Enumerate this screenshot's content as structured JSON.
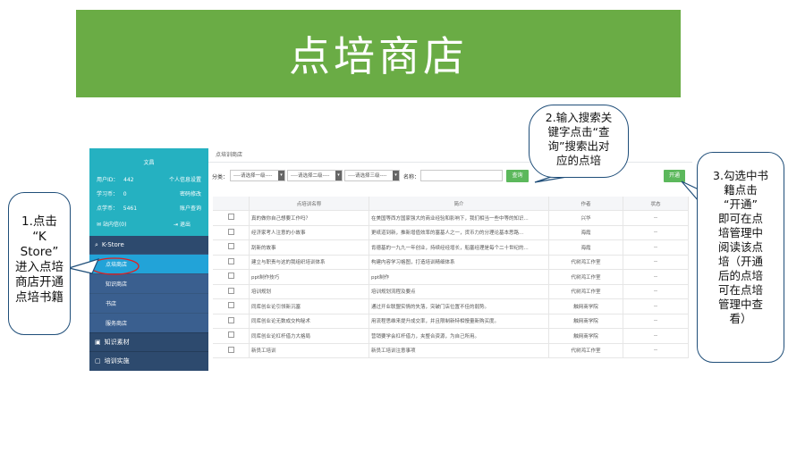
{
  "banner": {
    "title": "点培商店"
  },
  "sidebar": {
    "account_title": "文昌",
    "user_id_label": "用户ID：",
    "user_id_value": "442",
    "profile_settings": "个人信息设置",
    "study_label": "学习币：",
    "study_value": "0",
    "password_change": "密码修改",
    "balance_label": "点学币：",
    "balance_value": "5461",
    "account_query": "账户查询",
    "inbox_label": "站内信(0)",
    "logout_label": "退出",
    "section_kstore": "K-Store",
    "items": [
      {
        "label": "点培商店",
        "active": true
      },
      {
        "label": "知识商店",
        "active": false
      },
      {
        "label": "书店",
        "active": false
      },
      {
        "label": "服务商店",
        "active": false
      }
    ],
    "bottom_items": [
      {
        "label": "知识素材"
      },
      {
        "label": "培训实施"
      }
    ]
  },
  "main": {
    "breadcrumb": "点培训商店",
    "filters": {
      "category_label": "分类：",
      "select1": "----请选择一级----",
      "select2": "----请选择二级----",
      "select3": "----请选择三级----",
      "name_label": "名称：",
      "query_button": "查询",
      "open_button": "开通"
    },
    "table": {
      "headers": [
        "",
        "点培训名称",
        "简介",
        "作者",
        "状态"
      ],
      "rows": [
        {
          "name": "真的做你自己想要工作吗？",
          "intro": "在美国等西方国家强大的商业经验和影响下，我们相当一些中等的知识...",
          "author": "兴华",
          "status": "--"
        },
        {
          "name": "经济家考人注意的小故事",
          "intro": "更纸道到新，推新增值效率的塞基人之一，货币力的分理论基本思路...",
          "author": "海霞",
          "status": "--"
        },
        {
          "name": "刮新的故事",
          "intro": "肯德基的一九九一年创业，持续经经增长，船塞经理是每个二十世纪的...",
          "author": "海霞",
          "status": "--"
        },
        {
          "name": "建立与职责与这的我组织培训体系",
          "intro": "构建内容学习格图，打造培训精细体系",
          "author": "代树鸿工作室",
          "status": "--"
        },
        {
          "name": "ppt制作技巧",
          "intro": "ppt制作",
          "author": "代树鸿工作室",
          "status": "--"
        },
        {
          "name": "培训规划",
          "intro": "培训规划流程及要点",
          "author": "代树鸿工作室",
          "status": "--"
        },
        {
          "name": "同库创业论引领新沉塞",
          "intro": "通过开业联盟实情的失落，突破门店位置不佳的弱势。",
          "author": "触网商学院",
          "status": "--"
        },
        {
          "name": "同库创业论无数成交构秘术",
          "intro": "用流程思维来提升成交率，并且限制新特相慢量新购买度。",
          "author": "触网商学院",
          "status": "--"
        },
        {
          "name": "同库创业论杠杆借力大格局",
          "intro": "营销要学会杠杆借力，夹整合资源，为自己所用。",
          "author": "触网商学院",
          "status": "--"
        },
        {
          "name": "新员工培训",
          "intro": "新员工培训注意事项",
          "author": "代树鸿工作室",
          "status": "--"
        }
      ]
    }
  },
  "callouts": {
    "step1": [
      "1.点击",
      "“K",
      "Store”",
      "进入点培",
      "商店开通",
      "点培书籍"
    ],
    "step2": [
      "2.输入搜索关",
      "键字点击“查",
      "询”搜索出对",
      "应的点培"
    ],
    "step3": [
      "3.勾选中书",
      "籍点击",
      "“开通”",
      "即可在点",
      "培管理中",
      "阅读该点",
      "培（开通",
      "后的点培",
      "可在点培",
      "管理中查",
      "看）"
    ]
  },
  "colors": {
    "banner": "#6aac45",
    "sidebar_dark": "#2d4a6e",
    "sidebar_top": "#25b1c1",
    "active_item": "#22a3d8",
    "button_green": "#5cb85c",
    "callout_border": "#1f4e79",
    "highlight_ellipse": "#e02020"
  },
  "icons": [
    "search-icon",
    "mail-icon",
    "logout-icon",
    "knowledge-icon",
    "training-icon"
  ]
}
